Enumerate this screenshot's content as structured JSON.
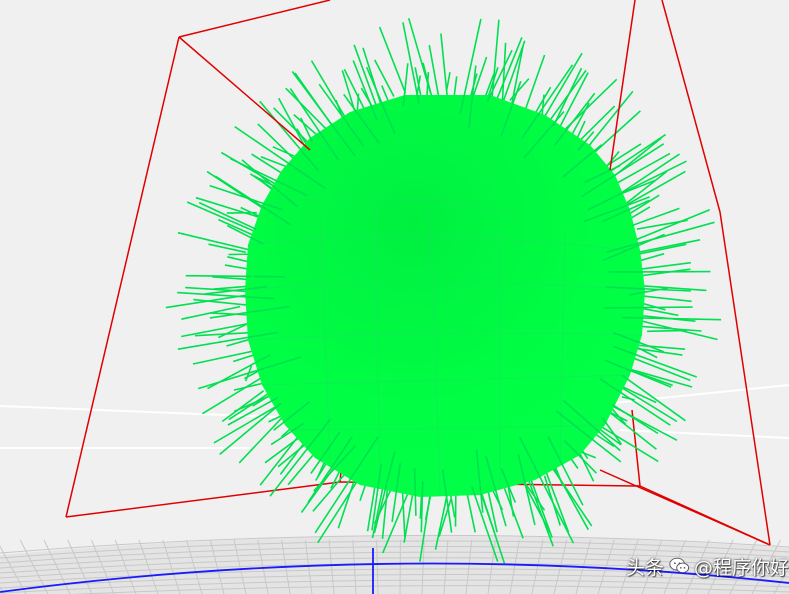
{
  "scene": {
    "background_color": "#f0f0f0",
    "ground_grid_color": "#c8c8c8",
    "ground_fill_color": "#e4e4e4",
    "axis_line_color": "#1a1aff",
    "white_line_color": "#ffffff",
    "bounding_box_color": "#e00000",
    "sphere_color": "#00ff44",
    "normal_line_color": "#00e050"
  },
  "watermark": {
    "platform": "头条",
    "account": "@程序你好",
    "icon": "wechat-like-chat-icon"
  }
}
